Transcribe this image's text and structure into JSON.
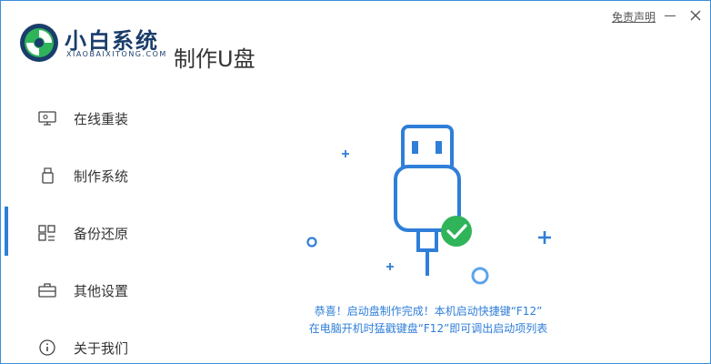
{
  "app": {
    "brand_cn": "小白系统",
    "brand_en": "XIAOBAIXITONG.COM",
    "page_title": "制作U盘",
    "disclaimer": "免责声明"
  },
  "sidebar": {
    "items": [
      {
        "label": "在线重装",
        "icon": "monitor-icon"
      },
      {
        "label": "制作系统",
        "icon": "usb-icon"
      },
      {
        "label": "备份还原",
        "icon": "grid-icon",
        "active": true
      },
      {
        "label": "其他设置",
        "icon": "briefcase-icon"
      },
      {
        "label": "关于我们",
        "icon": "info-icon"
      }
    ]
  },
  "main": {
    "message_line1": "恭喜！启动盘制作完成！本机启动快捷键“F12”",
    "message_line2": "在电脑开机时猛戳键盘“F12”即可调出启动项列表"
  },
  "colors": {
    "accent": "#2f7ed8",
    "success": "#2fb45a",
    "brand_dark": "#1a3d6b"
  }
}
